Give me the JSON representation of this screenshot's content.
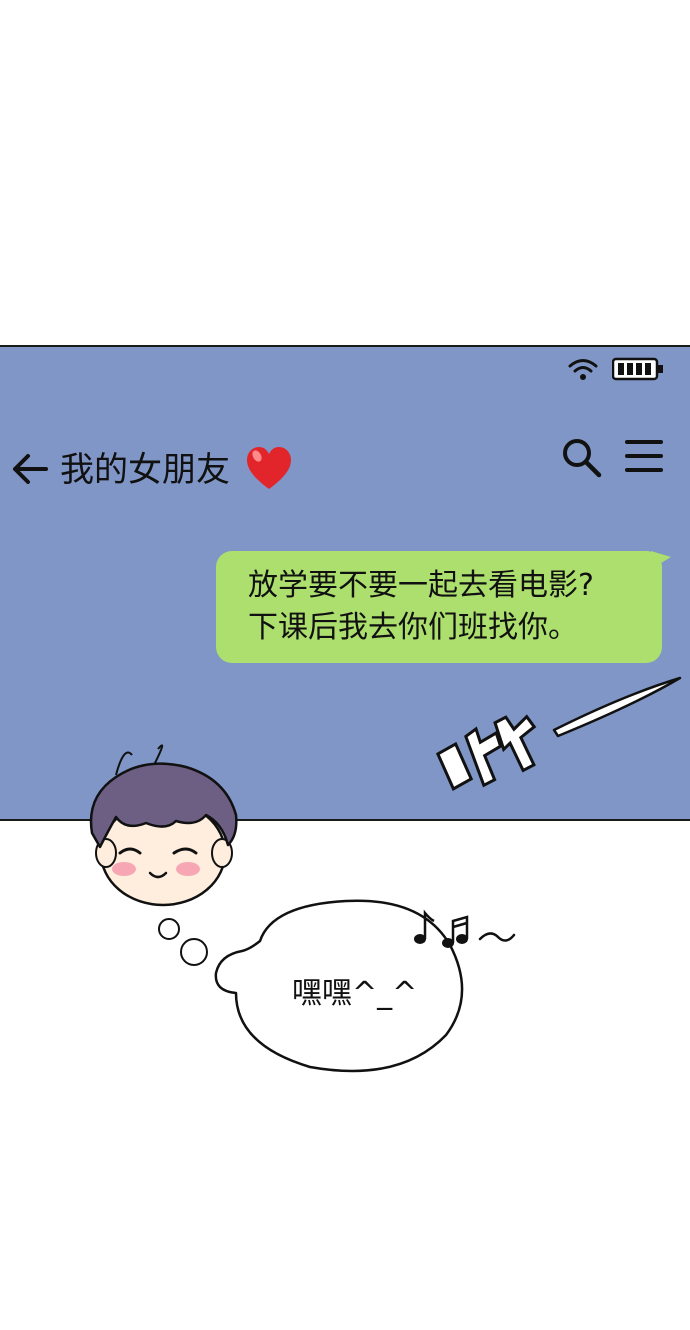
{
  "status_bar": {
    "wifi_icon": "wifi-icon",
    "battery_icon": "battery-icon"
  },
  "chat_header": {
    "back_icon": "arrow-left-icon",
    "contact_name": "我的女朋友",
    "heart_icon": "heart-icon",
    "search_icon": "search-icon",
    "menu_icon": "menu-icon"
  },
  "message": {
    "lines": [
      "放学要不要一起去看电影?",
      "下课后我去你们班找你。"
    ],
    "bubble_color": "#acdf6e"
  },
  "sound_effect": {
    "text": "咻"
  },
  "thought": {
    "text": "嘿嘿^_^"
  },
  "colors": {
    "phone_background": "#7f96c6",
    "heart": "#e2252b"
  }
}
